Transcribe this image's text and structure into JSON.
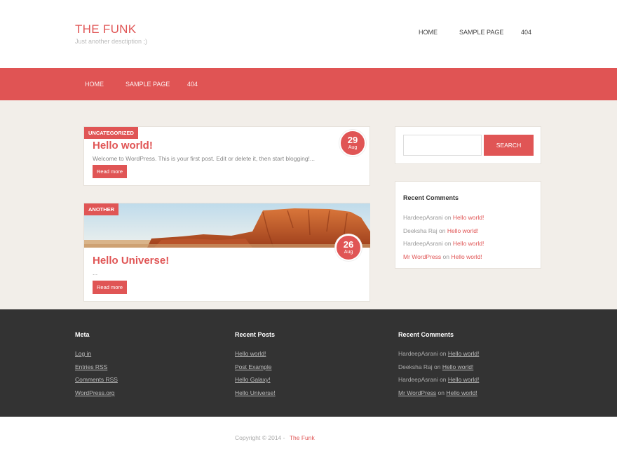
{
  "header": {
    "site_title": "THE FUNK",
    "site_description": "Just another desctiption ;)",
    "top_nav": [
      "HOME",
      "SAMPLE PAGE",
      "404"
    ]
  },
  "main_nav": [
    "HOME",
    "SAMPLE PAGE",
    "404"
  ],
  "posts": [
    {
      "category": "UNCATEGORIZED",
      "title": "Hello world!",
      "excerpt": "Welcome to WordPress. This is your first post. Edit or delete it, then start blogging!...",
      "read_more": "Read more",
      "date_day": "29",
      "date_month": "Aug"
    },
    {
      "category": "ANOTHER",
      "title": "Hello Universe!",
      "excerpt": "...",
      "read_more": "Read more",
      "date_day": "26",
      "date_month": "Aug"
    }
  ],
  "sidebar": {
    "search_placeholder": "",
    "search_button": "SEARCH",
    "recent_comments_title": "Recent Comments",
    "recent_comments": [
      {
        "author": "HardeepAsrani",
        "on": "on",
        "post": "Hello world!"
      },
      {
        "author": "Deeksha Raj",
        "on": "on",
        "post": "Hello world!"
      },
      {
        "author": "HardeepAsrani",
        "on": "on",
        "post": "Hello world!"
      },
      {
        "author": "Mr WordPress",
        "on": "on",
        "post": "Hello world!"
      }
    ]
  },
  "footer": {
    "meta_title": "Meta",
    "meta_links": [
      "Log in",
      "Entries RSS",
      "Comments RSS",
      "WordPress.org"
    ],
    "recent_posts_title": "Recent Posts",
    "recent_posts": [
      "Hello world!",
      "Post Example",
      "Hello Galaxy!",
      "Hello Universe!"
    ],
    "recent_comments_title": "Recent Comments",
    "recent_comments": [
      {
        "author": "HardeepAsrani",
        "on": "on",
        "post": "Hello world!"
      },
      {
        "author": "Deeksha Raj",
        "on": "on",
        "post": "Hello world!"
      },
      {
        "author": "HardeepAsrani",
        "on": "on",
        "post": "Hello world!"
      },
      {
        "author": "Mr WordPress",
        "on": "on",
        "post": "Hello world!"
      }
    ]
  },
  "copyright": {
    "text": "Copyright © 2014 -",
    "link": "The Funk"
  },
  "colors": {
    "accent": "#e05555",
    "footer_bg": "#333333",
    "content_bg": "#f2eee9"
  }
}
